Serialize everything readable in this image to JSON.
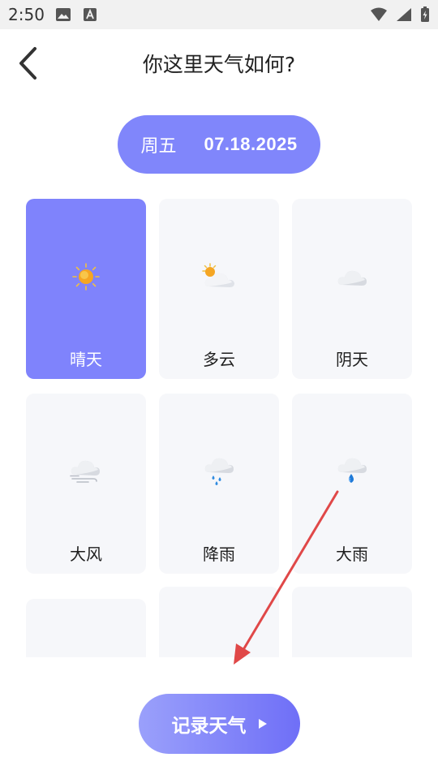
{
  "status_bar": {
    "time": "2:50",
    "left_icons": [
      "image-icon",
      "a-notification-icon"
    ],
    "right_icons": [
      "wifi-icon",
      "signal-icon",
      "battery-icon"
    ]
  },
  "header": {
    "title": "你这里天气如何?",
    "back_icon": "chevron-left-icon"
  },
  "date_pill": {
    "weekday": "周五",
    "date": "07.18.2025"
  },
  "weather_options": [
    {
      "label": "晴天",
      "icon": "sun-icon",
      "selected": true
    },
    {
      "label": "多云",
      "icon": "partly-cloudy-icon",
      "selected": false
    },
    {
      "label": "阴天",
      "icon": "cloud-icon",
      "selected": false
    },
    {
      "label": "大风",
      "icon": "windy-cloud-icon",
      "selected": false
    },
    {
      "label": "降雨",
      "icon": "rain-cloud-icon",
      "selected": false
    },
    {
      "label": "大雨",
      "icon": "heavy-rain-cloud-icon",
      "selected": false
    },
    {
      "label": "",
      "icon": "",
      "selected": false
    },
    {
      "label": "",
      "icon": "",
      "selected": false
    },
    {
      "label": "",
      "icon": "",
      "selected": false
    }
  ],
  "record_button": {
    "label": "记录天气",
    "icon": "play-triangle-icon"
  },
  "colors": {
    "accent": "#8086fb",
    "card_bg": "#f6f7fa",
    "annotation_arrow": "#e04848"
  }
}
